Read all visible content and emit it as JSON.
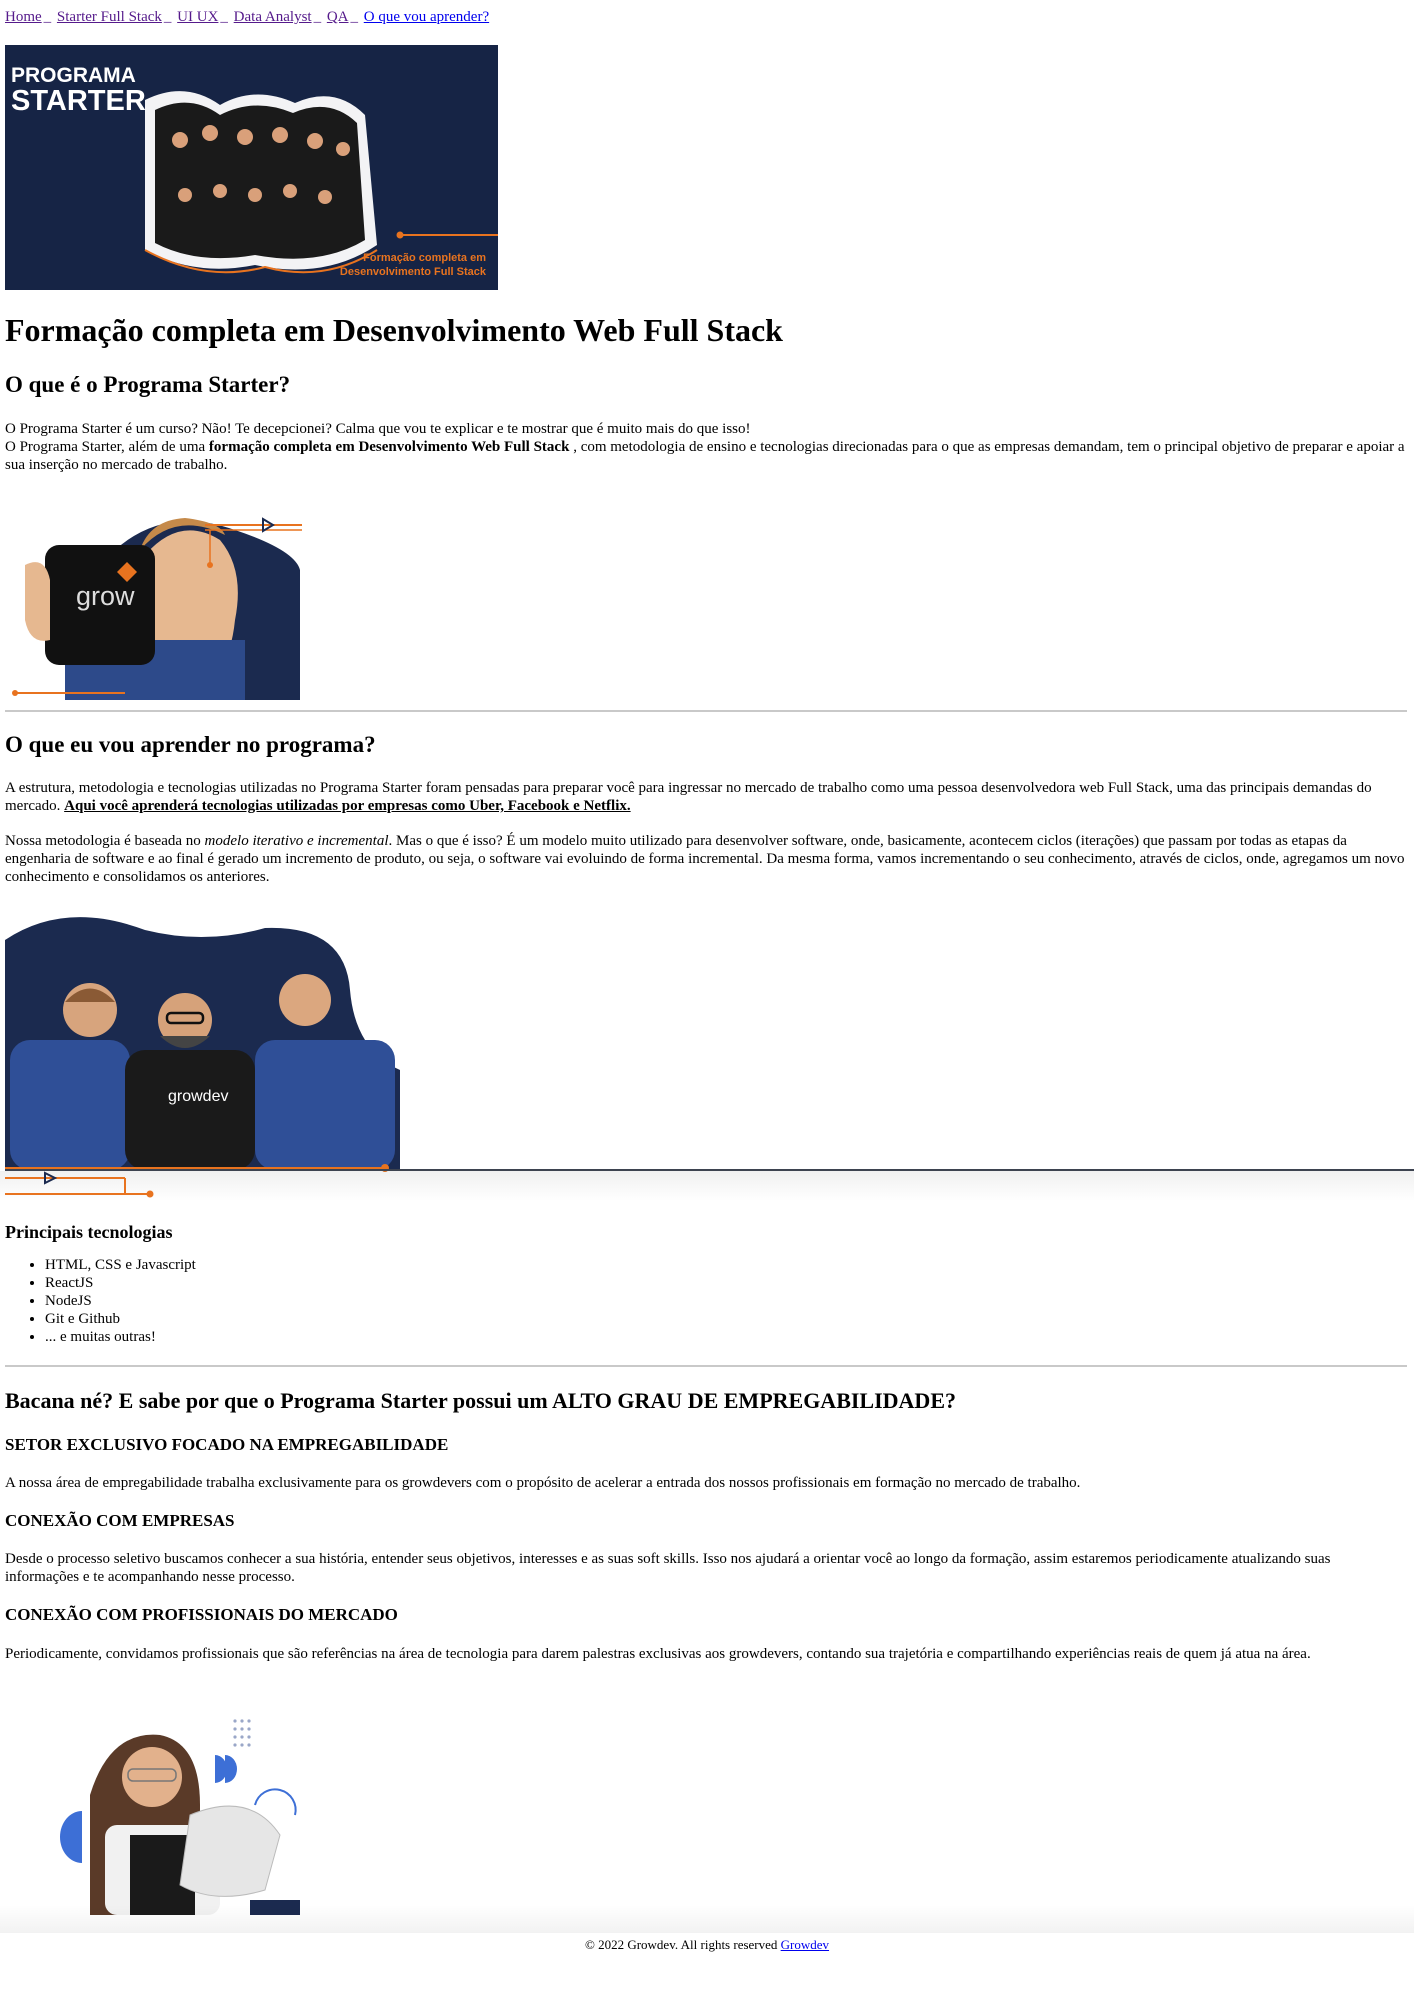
{
  "nav": {
    "links": [
      "Home",
      "Starter Full Stack",
      "UI UX",
      "Data Analyst",
      "QA",
      "O que vou aprender?"
    ],
    "separator": "_"
  },
  "banner": {
    "brand_line1": "PROGRAMA",
    "brand_line2": "STARTER",
    "tagline1": "Formação completa em",
    "tagline2": "Desenvolvimento Full Stack",
    "accent_color": "#e8731f",
    "bg_color": "#1b2a4f"
  },
  "hero": {
    "title": "Formação completa em Desenvolvimento Web Full Stack"
  },
  "about": {
    "heading": "O que é o Programa Starter?",
    "line1": "O Programa Starter é um curso? Não! Te decepcionei? Calma que vou te explicar e te mostrar que é muito mais do que isso!",
    "line2_before": "O Programa Starter, além de uma ",
    "line2_bold": "formação completa em Desenvolvimento Web Full Stack",
    "line2_after": " , com metodologia de ensino e tecnologias direcionadas para o que as empresas demandam, tem o principal objetivo de preparar e apoiar a sua inserção no mercado de trabalho.",
    "mug_brand": "grow"
  },
  "learn": {
    "heading": "O que eu vou aprender no programa?",
    "p1_before": "A estrutura, metodologia e tecnologias utilizadas no Programa Starter foram pensadas para preparar você para ingressar no mercado de trabalho como uma pessoa desenvolvedora web Full Stack, uma das principais demandas do mercado. ",
    "p1_link": "Aqui você aprenderá tecnologias utilizadas por empresas como Uber, Facebook e Netflix.",
    "p2_before": "Nossa metodologia é baseada no ",
    "p2_italic": "modelo iterativo e incremental",
    "p2_after": ". Mas o que é isso? É um modelo muito utilizado para desenvolver software, onde, basicamente, acontecem ciclos (iterações) que passam por todas as etapas da engenharia de software e ao final é gerado um incremento de produto, ou seja, o software vai evoluindo de forma incremental. Da mesma forma, vamos incrementando o seu conhecimento, através de ciclos, onde, agregamos um novo conhecimento e consolidamos os anteriores.",
    "shirt_brand": "growdev"
  },
  "tech": {
    "heading": "Principais tecnologias",
    "items": [
      "HTML, CSS e Javascript",
      "ReactJS",
      "NodeJS",
      "Git e Github",
      "... e muitas outras!"
    ]
  },
  "employ": {
    "heading": "Bacana né? E sabe por que o Programa Starter possui um ALTO GRAU DE EMPREGABILIDADE?",
    "s1_title": "SETOR EXCLUSIVO FOCADO NA EMPREGABILIDADE",
    "s1_text": "A nossa área de empregabilidade trabalha exclusivamente para os growdevers com o propósito de acelerar a entrada dos nossos profissionais em formação no mercado de trabalho.",
    "s2_title": "CONEXÃO COM EMPRESAS",
    "s2_text": "Desde o processo seletivo buscamos conhecer a sua história, entender seus objetivos, interesses e as suas soft skills. Isso nos ajudará a orientar você ao longo da formação, assim estaremos periodicamente atualizando suas informações e te acompanhando nesse processo.",
    "s3_title": "CONEXÃO COM PROFISSIONAIS DO MERCADO",
    "s3_text": "Periodicamente, convidamos profissionais que são referências na área de tecnologia para darem palestras exclusivas aos growdevers, contando sua trajetória e compartilhando experiências reais de quem já atua na área."
  },
  "footer": {
    "text": "© 2022 Growdev. All rights reserved ",
    "link": "Growdev"
  }
}
